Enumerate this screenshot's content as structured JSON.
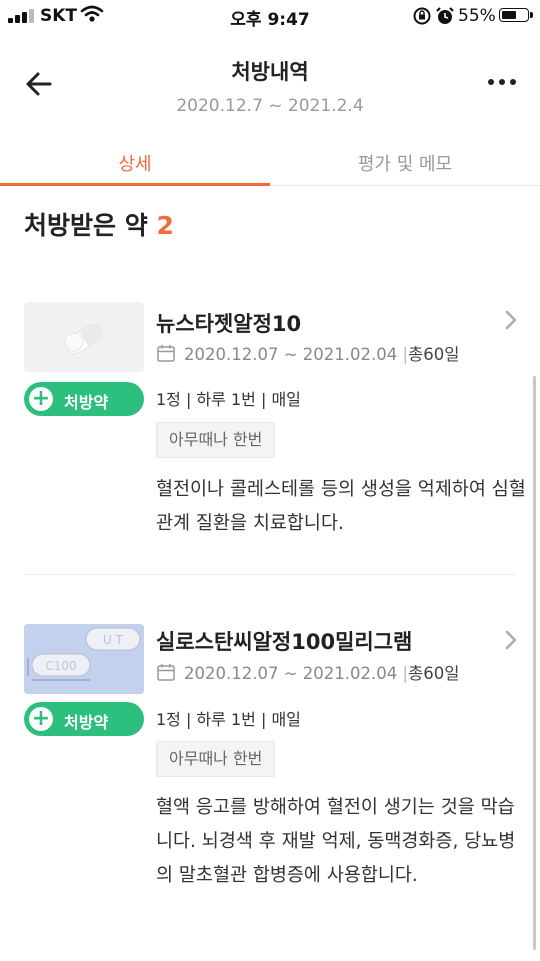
{
  "status_bar": {
    "carrier": "SKT",
    "time": "오후 9:47",
    "battery": "55%",
    "battery_level": 0.55
  },
  "header": {
    "title": "처방내역",
    "subtitle": "2020.12.7 ~ 2021.2.4",
    "back_icon": "arrow-left-icon",
    "more_icon": "more-horizontal-icon"
  },
  "tabs": [
    {
      "label": "상세",
      "active": true
    },
    {
      "label": "평가 및 메모",
      "active": false
    }
  ],
  "section": {
    "title": "처방받은 약",
    "count": "2"
  },
  "colors": {
    "accent": "#f26b3a",
    "badge": "#2dbf7e"
  },
  "drugs": [
    {
      "name": "뉴스타젯알정10",
      "period": "2020.12.07 ~ 2021.02.04",
      "separator": "|",
      "days": "총60일",
      "badge": "처방약",
      "dose": "1정 | 하루 1번 | 매일",
      "timing": "아무때나 한번",
      "description": "혈전이나 콜레스테롤 등의 생성을 억제하여 심혈관계 질환을 치료합니다."
    },
    {
      "name": "실로스탄씨알정100밀리그램",
      "period": "2020.12.07 ~ 2021.02.04",
      "separator": "|",
      "days": "총60일",
      "badge": "처방약",
      "dose": "1정 | 하루 1번 | 매일",
      "timing": "아무때나 한번",
      "description": "혈액 응고를 방해하여 혈전이 생기는 것을 막습니다. 뇌경색 후 재발 억제, 동맥경화증, 당뇨병의 말초혈관 합병증에 사용합니다.",
      "pill_marks": [
        "U T",
        "C100"
      ]
    }
  ]
}
